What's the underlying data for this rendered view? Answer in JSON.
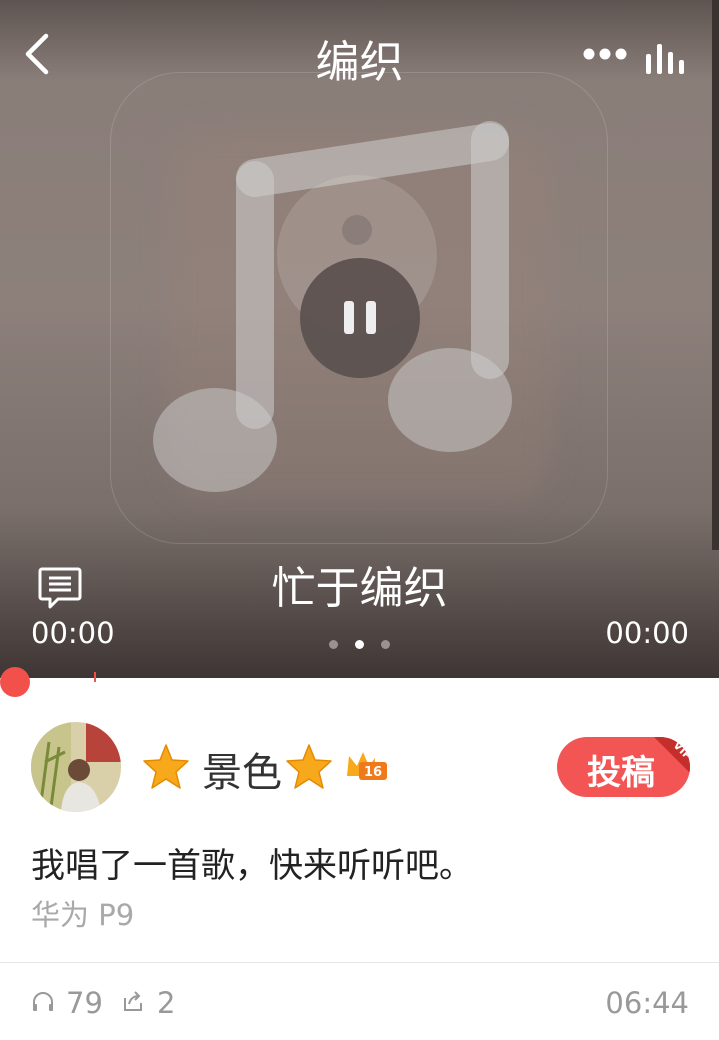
{
  "header": {
    "title": "编织",
    "icons": {
      "back": "chevron-left-icon",
      "more": "more-dots-icon",
      "equalizer": "equalizer-icon"
    }
  },
  "player": {
    "song_title": "忙于编织",
    "current_time": "00:00",
    "total_time": "00:00",
    "state": "playing",
    "page_indicator": {
      "count": 3,
      "active_index": 1
    },
    "progress": 0,
    "cover_icon": "music-note-icon",
    "comment_icon": "lyrics-comment-icon"
  },
  "post": {
    "user_name": "景色",
    "badge_level": "16",
    "contribute_label": "投稿",
    "vip_label": "VIP",
    "caption": "我唱了一首歌，快来听听吧。",
    "device": "华为 P9"
  },
  "stats": {
    "listens": "79",
    "shares": "2",
    "duration": "06:44",
    "icons": {
      "listens": "headphones-icon",
      "shares": "share-icon"
    }
  },
  "colors": {
    "accent": "#f2504a",
    "star": "#f7a81b",
    "text_primary": "#222222",
    "text_muted": "#999999"
  }
}
